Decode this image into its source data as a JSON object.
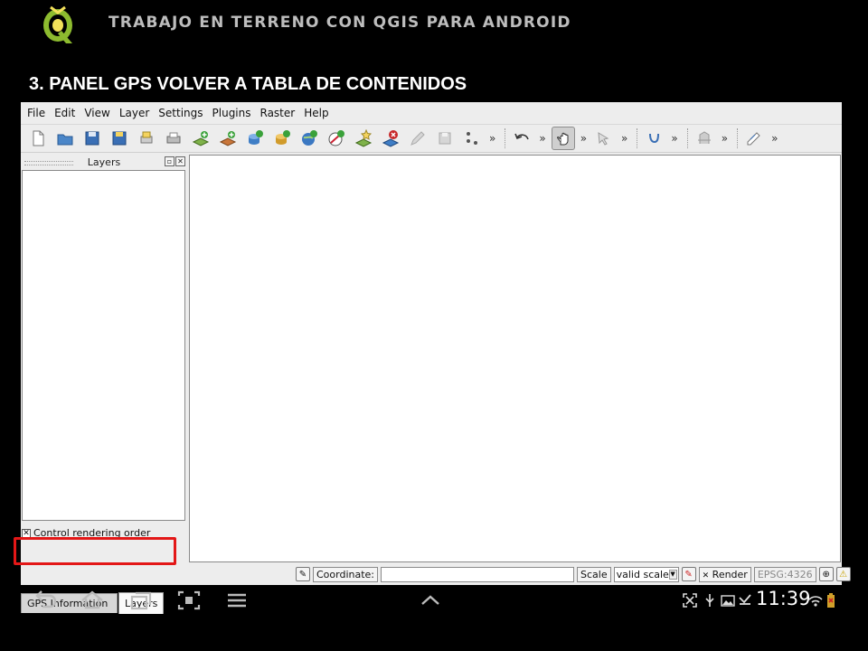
{
  "slide": {
    "title": "TRABAJO EN TERRENO CON QGIS PARA ANDROID",
    "subtitle": "3. PANEL GPS VOLVER A TABLA DE CONTENIDOS",
    "logo_icon": "qgis-logo-icon"
  },
  "menubar": {
    "items": [
      "File",
      "Edit",
      "View",
      "Layer",
      "Settings",
      "Plugins",
      "Raster",
      "Help"
    ]
  },
  "toolbar": {
    "more_label": "»",
    "icons": [
      "new-project-icon",
      "open-project-icon",
      "save-project-icon",
      "save-as-icon",
      "print-composer-icon",
      "print-icon",
      "add-vector-layer-icon",
      "add-raster-layer-icon",
      "add-postgis-layer-icon",
      "add-spatialite-layer-icon",
      "add-wms-layer-icon",
      "add-wfs-layer-icon",
      "new-shapefile-icon",
      "remove-layer-icon",
      "toggle-editing-icon",
      "save-edits-icon",
      "capture-point-icon",
      "undo-icon",
      "pan-icon",
      "identify-icon",
      "python-icon",
      "gps-tools-icon",
      "label-icon"
    ]
  },
  "layers_panel": {
    "title": "Layers",
    "control_rendering_order": "Control rendering order",
    "control_rendering_checked": true
  },
  "tabs": {
    "gps": "GPS Information",
    "layers": "Layers",
    "active": "layers"
  },
  "statusbar": {
    "coordinate_label": "Coordinate:",
    "coordinate_value": "",
    "scale_label": "Scale",
    "scale_value": "valid scale",
    "render_label": "Render",
    "render_checked": true,
    "crs": "EPSG:4326"
  },
  "android": {
    "clock": "11:39"
  },
  "colors": {
    "highlight": "#e31717",
    "background": "#000000",
    "window": "#ededed"
  }
}
